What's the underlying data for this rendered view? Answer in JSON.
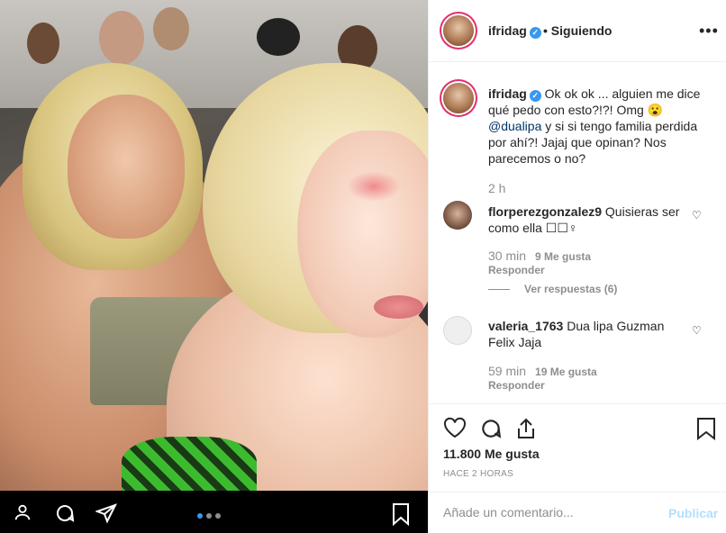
{
  "post": {
    "photo_alt": "",
    "carousel": {
      "total": 3,
      "active": 1
    }
  },
  "header": {
    "username": "ifridag",
    "follow_label": "• Siguiendo",
    "more_icon": "more-options-icon"
  },
  "caption": {
    "username": "ifridag",
    "text_before": " Ok ok ok ... alguien me dice qué pedo con esto?!?! Omg 😮",
    "mention": "@dualipa",
    "text_after": " y si si tengo familia perdida por ahí?! Jajaj que opinan? Nos parecemos o no?",
    "time": "2 h"
  },
  "comments": [
    {
      "username": "florperezgonzalez9",
      "text": " Quisieras ser como ella ☐☐♀",
      "time": "30 min",
      "likes": "9 Me gusta",
      "reply": "Responder",
      "view_replies": "Ver respuestas (6)"
    },
    {
      "username": "valeria_1763",
      "text": " Dua lipa Guzman Felix Jaja",
      "time": "59 min",
      "likes": "19 Me gusta",
      "reply": "Responder"
    }
  ],
  "actions": {
    "likes": "11.800 Me gusta",
    "time_ago": "HACE 2 HORAS"
  },
  "comment_form": {
    "placeholder": "Añade un comentario...",
    "publish_label": "Publicar"
  },
  "colors": {
    "accent": "#3897f0",
    "publish_disabled": "#b2dffc",
    "muted": "#8e8e8e"
  }
}
